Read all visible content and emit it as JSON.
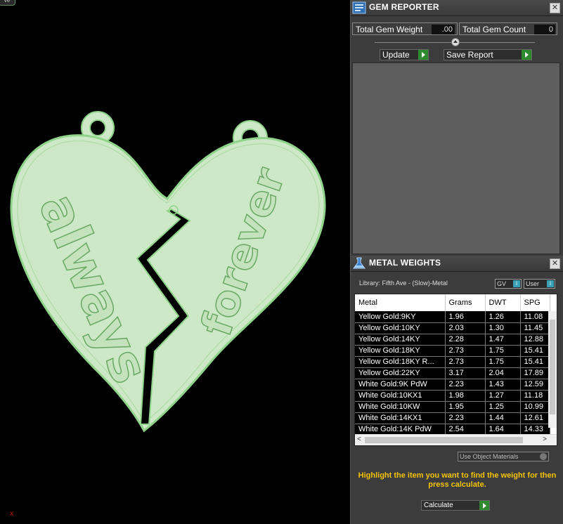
{
  "viewport": {
    "tab_label": "ve",
    "axis_label": "x",
    "colors": {
      "model_fill": "#cde8c6",
      "model_edge": "#8fd48a",
      "text_stroke": "#6aa866",
      "background": "#000000"
    },
    "engraving": {
      "left_text": "always",
      "right_text": "forever"
    }
  },
  "gem_reporter": {
    "title": "GEM REPORTER",
    "icon": "gem-reporter-icon",
    "total_gem_weight_label": "Total Gem Weight",
    "total_gem_weight_value": ".00",
    "total_gem_count_label": "Total Gem Count",
    "total_gem_count_value": "0",
    "update_label": "Update",
    "save_report_label": "Save Report"
  },
  "metal_weights": {
    "title": "METAL WEIGHTS",
    "icon": "flask-icon",
    "library_label": "Library: Fifth Ave - (Slow)-Metal",
    "gv_label": "GV",
    "user_label": "User",
    "columns": [
      "Metal",
      "Grams",
      "DWT",
      "SPG"
    ],
    "rows": [
      [
        "Yellow Gold:9KY",
        "1.96",
        "1.26",
        "11.08"
      ],
      [
        "Yellow Gold:10KY",
        "2.03",
        "1.30",
        "11.45"
      ],
      [
        "Yellow Gold:14KY",
        "2.28",
        "1.47",
        "12.88"
      ],
      [
        "Yellow Gold:18KY",
        "2.73",
        "1.75",
        "15.41"
      ],
      [
        "Yellow Gold:18KY R...",
        "2.73",
        "1.75",
        "15.41"
      ],
      [
        "Yellow Gold:22KY",
        "3.17",
        "2.04",
        "17.89"
      ],
      [
        "White Gold:9K PdW",
        "2.23",
        "1.43",
        "12.59"
      ],
      [
        "White Gold:10KX1",
        "1.98",
        "1.27",
        "11.18"
      ],
      [
        "White Gold:10KW",
        "1.95",
        "1.25",
        "10.99"
      ],
      [
        "White Gold:14KX1",
        "2.23",
        "1.44",
        "12.61"
      ],
      [
        "White Gold:14K PdW",
        "2.54",
        "1.64",
        "14.33"
      ]
    ],
    "use_object_materials_label": "Use Object Materials",
    "hint": "Highlight the item you want to find the weight for then press calculate.",
    "calculate_label": "Calculate",
    "hint_color": "#f5c400"
  }
}
